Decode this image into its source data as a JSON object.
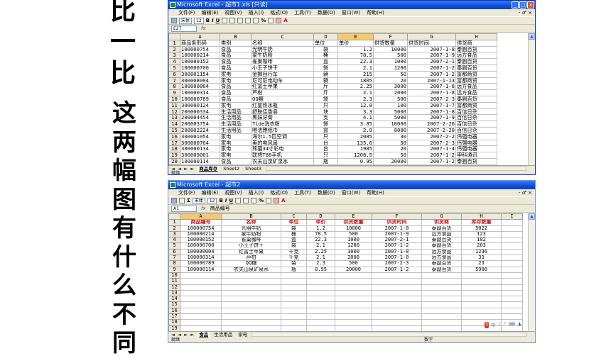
{
  "side_top": [
    "比",
    "一",
    "比"
  ],
  "side_main": [
    "这",
    "两",
    "幅",
    "图",
    "有",
    "什",
    "么",
    "不",
    "同"
  ],
  "colors": {
    "title_blue": "#0a4fd6",
    "header_red": "#d01010",
    "selected_col": "#f7c96b"
  },
  "win1": {
    "title": "Microsoft Excel - 超市1.xls [只读]",
    "menus": [
      "文件(F)",
      "编辑(E)",
      "视图(V)",
      "插入(I)",
      "格式(O)",
      "工具(T)",
      "数据(D)",
      "窗口(W)",
      "帮助(H)"
    ],
    "font_name": "宋体",
    "font_size": "12",
    "cell_ref": "E27",
    "fx": "fx",
    "formula": "",
    "columns": [
      "A",
      "B",
      "C",
      "D",
      "E",
      "F",
      "G",
      "H"
    ],
    "rows": [
      [
        "1",
        "商品条形码",
        "类别",
        "名称",
        "单位",
        "单价",
        "供货数量",
        "供货时间",
        "供货商"
      ],
      [
        "2",
        "100000754",
        "食品",
        "光明牛奶",
        "袋",
        "1.2",
        "10000",
        "2007-1-8",
        "泰副百货"
      ],
      [
        "3",
        "100000214",
        "食品",
        "蒙牛奶粉",
        "桶",
        "78.5",
        "500",
        "2007-1-9",
        "远方食品"
      ],
      [
        "4",
        "100000152",
        "食品",
        "雀巢咖啡",
        "盒",
        "22.3",
        "1000",
        "2007-2-1",
        "泰副百货"
      ],
      [
        "5",
        "100000700",
        "食品",
        "小王子饼干",
        "袋",
        "2.1",
        "1200",
        "2007-1-2",
        "泰副百货"
      ],
      [
        "6",
        "300001154",
        "家电",
        "金狮自行车",
        "辆",
        "215",
        "50",
        "2007-1-2",
        "富都商贸"
      ],
      [
        "7",
        "300008004",
        "家电",
        "尼可尼电动车",
        "辆",
        "1805",
        "20",
        "2007-1-13",
        "富都商贸"
      ],
      [
        "8",
        "100000004",
        "食品",
        "红富士苹果",
        "斤",
        "2.25",
        "3000",
        "2007-1-8",
        "远方食品"
      ],
      [
        "9",
        "100000314",
        "食品",
        "芦柑",
        "斤",
        "2.1",
        "2000",
        "2007-1-8",
        "远方食品"
      ],
      [
        "10",
        "100000789",
        "食品",
        "QQ糖",
        "袋",
        "2.3",
        "500",
        "2007-2-3",
        "泰副百货"
      ],
      [
        "11",
        "300000124",
        "家电",
        "红星热水瓶",
        "只",
        "12.8",
        "100",
        "2007-1-7",
        "富都商贸"
      ],
      [
        "12",
        "200000334",
        "生活用品",
        "舒肤佳香皂",
        "块",
        "3.3",
        "5000",
        "2007-1-8",
        "百信日杂"
      ],
      [
        "13",
        "200004454",
        "生活用品",
        "黑妹牙膏",
        "支",
        "4.1",
        "5000",
        "2007-1-9",
        "百信日杂"
      ],
      [
        "14",
        "200003754",
        "生活用品",
        "Tide洗衣粉",
        "袋",
        "3.85",
        "10000",
        "2007-2-20",
        "百信日杂"
      ],
      [
        "15",
        "200002224",
        "生活用品",
        "唯洁雅纸巾",
        "盒",
        "2.8",
        "8000",
        "2007-2-20",
        "百信日杂"
      ],
      [
        "16",
        "300001054",
        "家电",
        "海尔1.5匹空调",
        "只",
        "2085",
        "30",
        "2007-2-2",
        "伟强电器"
      ],
      [
        "17",
        "300000764",
        "家电",
        "美的电风扇",
        "台",
        "135.6",
        "50",
        "2007-2-3",
        "伟强电器"
      ],
      [
        "18",
        "300000134",
        "家电",
        "熊猫34寸彩电",
        "台",
        "1985",
        "20",
        "2007-1-4",
        "伟强电器"
      ],
      [
        "19",
        "300009001",
        "家电",
        "联想T88手机",
        "只",
        "1208.5",
        "50",
        "2007-1-2",
        "申科通讯"
      ],
      [
        "20",
        "100000114",
        "食品",
        "农夫山泉矿泉水",
        "瓶",
        "0.95",
        "20000",
        "2007-1-2",
        "泰副百货"
      ],
      [
        "21",
        "200005011",
        "生活用品",
        "玉兰油",
        "瓶",
        "21.5",
        "600",
        "2007-1-2",
        "泰副百货"
      ]
    ],
    "tab_nav": "◄ ◄ ► ►",
    "tabs": [
      "商品库存",
      "Sheet2",
      "Sheet3"
    ],
    "status": "就绪"
  },
  "win2": {
    "title": "Microsoft Excel - 超市2",
    "menus": [
      "文件(F)",
      "编辑(E)",
      "视图(V)",
      "插入(I)",
      "格式(O)",
      "工具(T)",
      "数据(D)",
      "窗口(W)",
      "帮助(H)"
    ],
    "font_name": "宋体",
    "font_size": "12",
    "cell_ref": "A1",
    "fx": "fx",
    "formula": "商品编号",
    "columns": [
      "A",
      "B",
      "C",
      "D",
      "E",
      "F",
      "G",
      "H",
      "I"
    ],
    "header": [
      "商品编号",
      "名称",
      "单位",
      "单价",
      "供货数量",
      "供货时间",
      "供货商",
      "库存数量"
    ],
    "rows": [
      [
        "2",
        "100000754",
        "光明牛奶",
        "袋",
        "1.2",
        "10000",
        "2007-1-8",
        "泰副百货",
        "5022"
      ],
      [
        "3",
        "100000214",
        "蒙牛奶粉",
        "桶",
        "78.5",
        "500",
        "2007-1-9",
        "远方食品",
        "123"
      ],
      [
        "4",
        "100000152",
        "雀巢咖啡",
        "盒",
        "22.3",
        "1000",
        "2007-2-1",
        "泰副百货",
        "102"
      ],
      [
        "5",
        "100000700",
        "小王子饼干",
        "袋",
        "2.1",
        "1200",
        "2007-1-2",
        "泰副百货",
        "203"
      ],
      [
        "6",
        "100000004",
        "红富士苹果",
        "千克",
        "2.25",
        "3000",
        "2007-1-8",
        "远方食品",
        "1236"
      ],
      [
        "7",
        "100000314",
        "芦柑",
        "千克",
        "2.1",
        "2000",
        "2007-1-8",
        "远方食品",
        "33"
      ],
      [
        "8",
        "100000789",
        "QQ糖",
        "袋",
        "2.3",
        "500",
        "2007-2-3",
        "泰副百货",
        "23"
      ],
      [
        "9",
        "100000114",
        "农夫山泉矿泉水",
        "瓶",
        "0.95",
        "20000",
        "2007-1-2",
        "泰副百货",
        "5900"
      ]
    ],
    "empty_rows": [
      "10",
      "11",
      "12",
      "13",
      "14",
      "15",
      "16",
      "17",
      "18",
      "19"
    ],
    "tab_nav": "◄ ◄ ► ►",
    "tabs": [
      "食品",
      "生活用品",
      "家电"
    ],
    "ime": [
      "S",
      "中",
      "♪",
      "°",
      "⌨",
      "♟"
    ],
    "status": "就绪",
    "status_right": "数字"
  }
}
